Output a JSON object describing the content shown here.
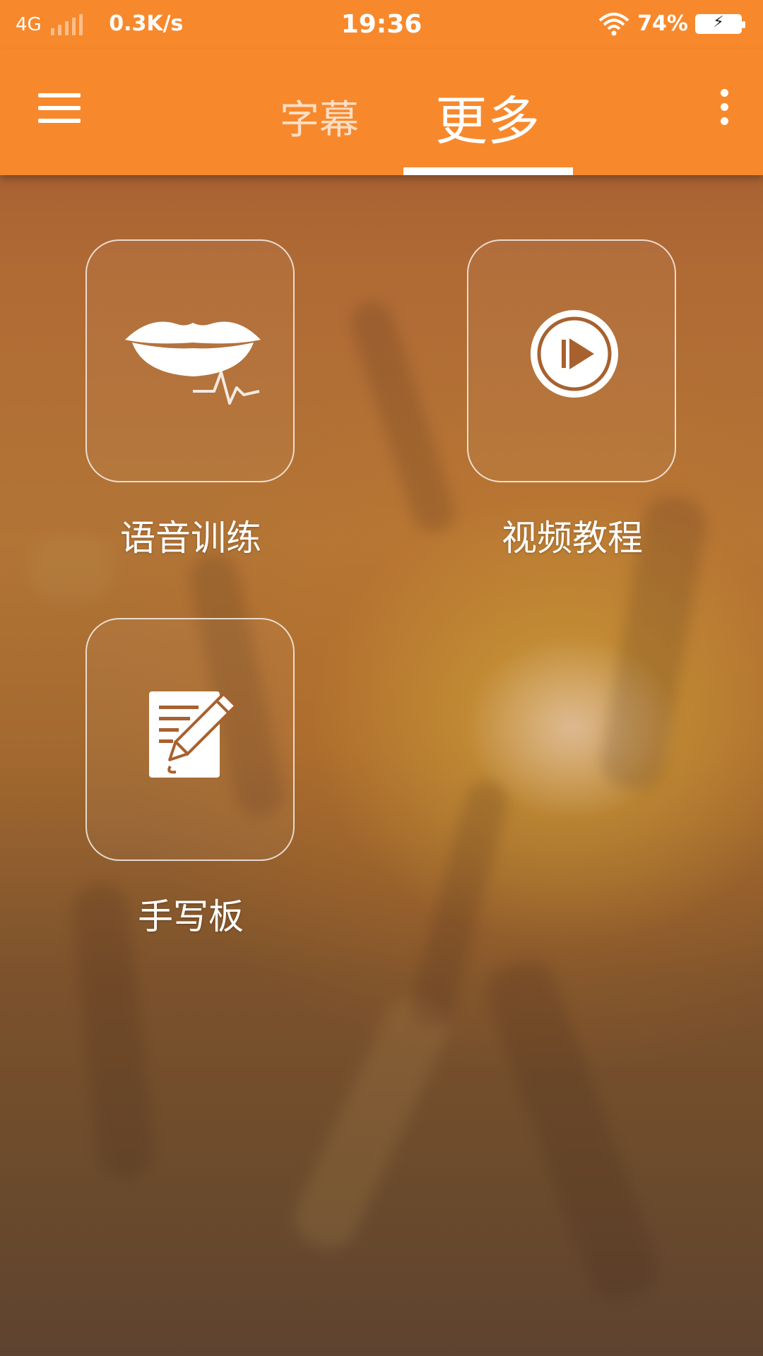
{
  "status_bar": {
    "network": "4G",
    "speed": "0.3K/s",
    "time": "19:36",
    "battery_percent": "74%",
    "battery_glyph": "⚡"
  },
  "toolbar": {
    "tabs": [
      {
        "label": "字幕",
        "selected": false
      },
      {
        "label": "更多",
        "selected": true
      }
    ],
    "accent_color": "#f7892c"
  },
  "grid": {
    "items": [
      {
        "label": "语音训练",
        "icon": "lips-waveform-icon"
      },
      {
        "label": "视频教程",
        "icon": "play-circle-icon"
      },
      {
        "label": "手写板",
        "icon": "notepad-pen-icon"
      }
    ]
  }
}
